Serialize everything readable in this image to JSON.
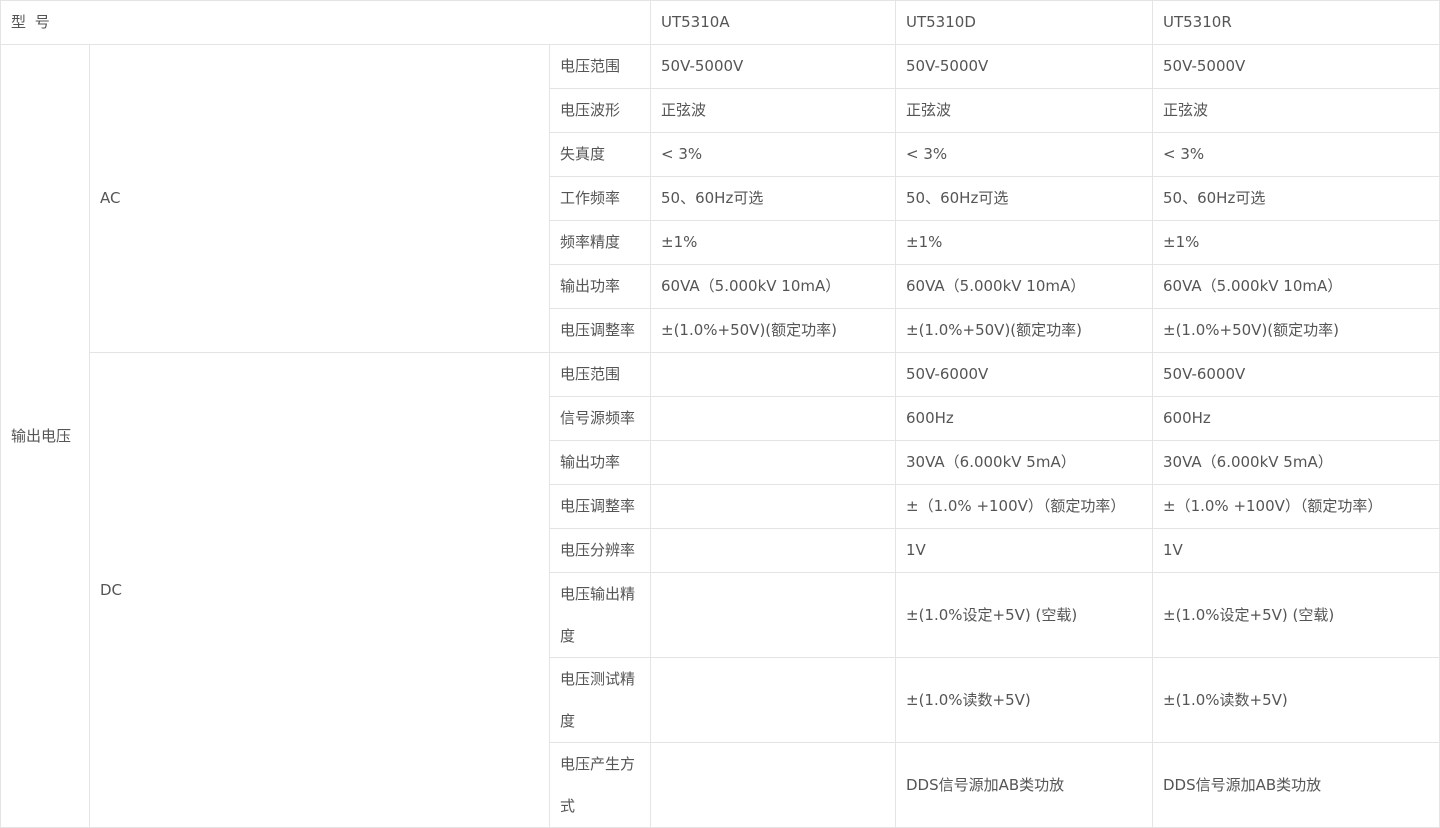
{
  "header": {
    "label": "型 号",
    "models": [
      "UT5310A",
      "UT5310D",
      "UT5310R"
    ]
  },
  "section_label": "输出电压",
  "ac": {
    "label": "AC",
    "rows": [
      {
        "param": "电压范围",
        "values": [
          "50V-5000V",
          "50V-5000V",
          "50V-5000V"
        ]
      },
      {
        "param": "电压波形",
        "values": [
          "正弦波",
          "正弦波",
          "正弦波"
        ]
      },
      {
        "param": "失真度",
        "values": [
          "< 3%",
          "< 3%",
          "< 3%"
        ]
      },
      {
        "param": "工作频率",
        "values": [
          "50、60Hz可选",
          "50、60Hz可选",
          "50、60Hz可选"
        ]
      },
      {
        "param": "频率精度",
        "values": [
          "±1%",
          "±1%",
          "±1%"
        ]
      },
      {
        "param": "输出功率",
        "values": [
          "60VA（5.000kV 10mA）",
          "60VA（5.000kV 10mA）",
          "60VA（5.000kV 10mA）"
        ]
      },
      {
        "param": "电压调整率",
        "values": [
          "±(1.0%+50V)(额定功率)",
          "±(1.0%+50V)(额定功率)",
          "±(1.0%+50V)(额定功率)"
        ]
      }
    ]
  },
  "dc": {
    "label": "DC",
    "rows": [
      {
        "param": "电压范围",
        "values": [
          "",
          "50V-6000V",
          "50V-6000V"
        ]
      },
      {
        "param": "信号源频率",
        "values": [
          "",
          "600Hz",
          "600Hz"
        ]
      },
      {
        "param": "输出功率",
        "values": [
          "",
          "30VA（6.000kV 5mA）",
          "30VA（6.000kV 5mA）"
        ]
      },
      {
        "param": "电压调整率",
        "values": [
          "",
          "±（1.0% +100V）（额定功率）",
          "±（1.0% +100V）（额定功率）"
        ]
      },
      {
        "param": "电压分辨率",
        "values": [
          "",
          "1V",
          "1V"
        ]
      },
      {
        "param": "电压输出精度",
        "values": [
          "",
          "±(1.0%设定+5V) (空载)",
          "±(1.0%设定+5V) (空载)"
        ]
      },
      {
        "param": "电压测试精度",
        "values": [
          "",
          "±(1.0%读数+5V)",
          "±(1.0%读数+5V)"
        ]
      },
      {
        "param": "电压产生方式",
        "values": [
          "",
          "DDS信号源加AB类功放",
          "DDS信号源加AB类功放"
        ]
      }
    ]
  }
}
